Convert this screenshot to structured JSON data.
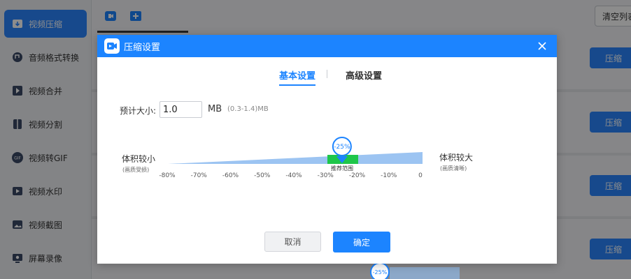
{
  "sidebar": {
    "items": [
      {
        "label": "视频压缩",
        "icon": "video-compress-icon"
      },
      {
        "label": "音频格式转换",
        "icon": "audio-convert-icon"
      },
      {
        "label": "视频合并",
        "icon": "video-merge-icon"
      },
      {
        "label": "视频分割",
        "icon": "video-split-icon"
      },
      {
        "label": "视频转GIF",
        "icon": "gif-icon"
      },
      {
        "label": "视频水印",
        "icon": "watermark-icon"
      },
      {
        "label": "视频截图",
        "icon": "screenshot-icon"
      },
      {
        "label": "屏幕录像",
        "icon": "screen-record-icon"
      }
    ]
  },
  "toolbar": {
    "clear_label": "清空列表"
  },
  "rows": {
    "compress_label": "压缩"
  },
  "dialog": {
    "title": "压缩设置",
    "tabs": [
      {
        "label": "基本设置"
      },
      {
        "label": "高级设置"
      }
    ],
    "size_label": "预计大小:",
    "size_value": "1.0",
    "size_unit": "MB",
    "size_range": "(0.3-1.4)MB",
    "left_label": "体积较小",
    "left_sub": "(画质受损)",
    "right_label": "体积较大",
    "right_sub": "(画质清晰)",
    "slider": {
      "value_label": "-25%",
      "value": -25,
      "recommend_label": "推荐范围",
      "ticks": [
        "-80%",
        "-70%",
        "-60%",
        "-50%",
        "-40%",
        "-30%",
        "-20%",
        "-10%",
        "0"
      ]
    },
    "cancel_label": "取消",
    "ok_label": "确定"
  },
  "colors": {
    "accent": "#1c84ff",
    "recommend": "#1ec64a"
  }
}
